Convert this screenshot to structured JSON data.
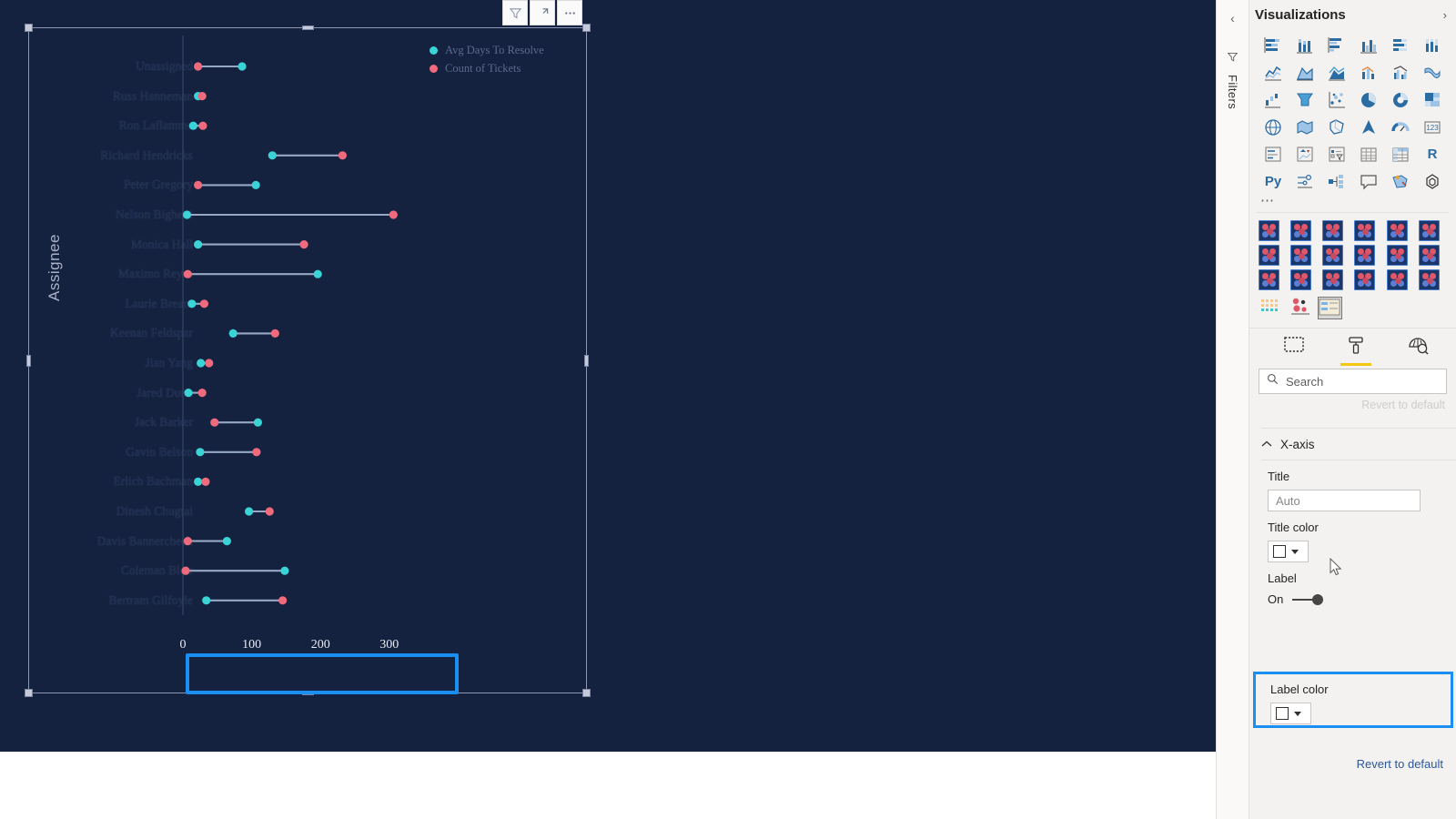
{
  "visual_toolbar": {
    "filter_icon": "filter-funnel-icon",
    "focus_icon": "focus-mode-icon",
    "more_icon": "more-options-icon"
  },
  "chart_data": {
    "type": "scatter",
    "subtype": "dumbbell",
    "title": "",
    "xlabel": "",
    "ylabel": "Assignee",
    "xlim": [
      0,
      340
    ],
    "xticks": [
      0,
      100,
      200,
      300
    ],
    "xtick_labels": [
      "0",
      "100",
      "200",
      "300"
    ],
    "grid": false,
    "legend_position": "top-right",
    "legend": [
      {
        "name": "Avg Days To Resolve",
        "color": "#3ad3d6"
      },
      {
        "name": "Count of Tickets",
        "color": "#ef6a7d"
      }
    ],
    "categories": [
      "Unassigned",
      "Russ Hanneman",
      "Ron Laflamme",
      "Richard Hendricks",
      "Peter Gregory",
      "Nelson Bighetti",
      "Monica Hall",
      "Maximo Reyes",
      "Laurie Bream",
      "Keenan Feldspar",
      "Jian Yang",
      "Jared Dunn",
      "Jack Barker",
      "Gavin Belson",
      "Erlich Bachman",
      "Dinesh Chugtai",
      "Davis Bannercheck",
      "Coleman Blair",
      "Bertram Gilfoyle"
    ],
    "series": [
      {
        "name": "Avg Days To Resolve",
        "color": "#3ad3d6",
        "values": [
          86,
          22,
          15,
          130,
          106,
          6,
          22,
          196,
          13,
          73,
          26,
          8,
          109,
          25,
          22,
          96,
          64,
          148,
          34
        ]
      },
      {
        "name": "Count of Tickets",
        "color": "#ef6a7d",
        "values": [
          22,
          28,
          29,
          232,
          22,
          306,
          176,
          7,
          31,
          134,
          38,
          28,
          46,
          107,
          33,
          126,
          7,
          4,
          145
        ]
      }
    ]
  },
  "axis_highlight": {
    "present": true,
    "color": "#1b8ef2"
  },
  "right_panel": {
    "filters_rail": {
      "collapse_icon": "chevron-left-icon",
      "funnel_icon": "filter-funnel-icon",
      "label": "Filters"
    },
    "header": {
      "title": "Visualizations",
      "expand_icon": "chevron-right-icon"
    },
    "visual_types": [
      {
        "name": "stacked-bar-chart"
      },
      {
        "name": "stacked-column-chart"
      },
      {
        "name": "clustered-bar-chart"
      },
      {
        "name": "clustered-column-chart"
      },
      {
        "name": "100-percent-stacked-bar-chart"
      },
      {
        "name": "100-percent-stacked-column-chart"
      },
      {
        "name": "line-chart"
      },
      {
        "name": "area-chart"
      },
      {
        "name": "stacked-area-chart"
      },
      {
        "name": "line-and-stacked-column-chart"
      },
      {
        "name": "line-and-clustered-column-chart"
      },
      {
        "name": "ribbon-chart"
      },
      {
        "name": "waterfall-chart"
      },
      {
        "name": "funnel-chart"
      },
      {
        "name": "scatter-chart"
      },
      {
        "name": "pie-chart"
      },
      {
        "name": "donut-chart"
      },
      {
        "name": "treemap-chart"
      },
      {
        "name": "map-visual"
      },
      {
        "name": "filled-map-visual"
      },
      {
        "name": "shape-map-visual"
      },
      {
        "name": "arcgis-map-visual"
      },
      {
        "name": "gauge-visual"
      },
      {
        "name": "card-visual"
      },
      {
        "name": "multi-row-card-visual"
      },
      {
        "name": "kpi-visual"
      },
      {
        "name": "slicer-visual"
      },
      {
        "name": "table-visual"
      },
      {
        "name": "matrix-visual"
      },
      {
        "name": "r-script-visual",
        "glyph": "R"
      },
      {
        "name": "python-script-visual",
        "glyph": "Py"
      },
      {
        "name": "key-influencers-visual"
      },
      {
        "name": "decomposition-tree-visual"
      },
      {
        "name": "qna-visual"
      },
      {
        "name": "smart-narrative-visual"
      },
      {
        "name": "paginated-report-visual"
      }
    ],
    "more_visuals_icon": "more-visuals-ellipsis",
    "custom_visual_count": 18,
    "custom_visual_extras": [
      {
        "name": "dot-matrix-custom-visual"
      },
      {
        "name": "bubble-cluster-custom-visual"
      },
      {
        "name": "table-card-custom-visual",
        "selected": true
      }
    ],
    "tabs": [
      {
        "name": "fields-tab",
        "icon": "fields-grid-icon",
        "selected": false
      },
      {
        "name": "format-tab",
        "icon": "paint-roller-icon",
        "selected": true
      },
      {
        "name": "analytics-tab",
        "icon": "magnifier-chart-icon",
        "selected": false
      }
    ],
    "search": {
      "placeholder": "Search",
      "value": "",
      "icon": "search-icon"
    },
    "scrolled_out_text": "Revert to default",
    "format_sections": [
      {
        "name": "x-axis",
        "label": "X-axis",
        "expanded": true,
        "chevron": "chevron-up-icon",
        "settings": {
          "title_label": "Title",
          "title_value": "Auto",
          "title_color_label": "Title color",
          "title_color_value": "#ffffff",
          "label_label": "Label",
          "label_toggle_text": "On",
          "label_toggle_on": true,
          "label_color_label": "Label color",
          "label_color_value": "#ffffff",
          "label_color_highlighted": true
        }
      }
    ],
    "revert_link": "Revert to default"
  }
}
